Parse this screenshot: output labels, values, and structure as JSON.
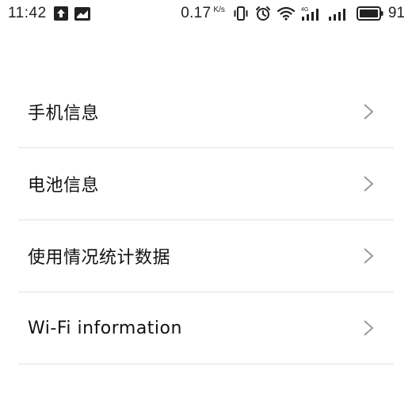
{
  "status_bar": {
    "time": "11:42",
    "net_speed_value": "0.17",
    "net_speed_unit": "K/s",
    "battery_level": "91",
    "signal_tech": "4G",
    "icons": [
      "upload-icon",
      "image-icon",
      "vibrate-icon",
      "alarm-icon",
      "wifi-icon",
      "signal-4g-icon",
      "signal-icon",
      "battery-icon"
    ]
  },
  "settings": {
    "items": [
      {
        "label": "手机信息",
        "icon": "chevron-right-icon"
      },
      {
        "label": "电池信息",
        "icon": "chevron-right-icon"
      },
      {
        "label": "使用情况统计数据",
        "icon": "chevron-right-icon"
      },
      {
        "label": "Wi-Fi information",
        "icon": "chevron-right-icon"
      }
    ]
  },
  "colors": {
    "background": "#ffffff",
    "text": "#111111",
    "divider": "#e2e2e2",
    "chevron": "#9a9a9a"
  }
}
